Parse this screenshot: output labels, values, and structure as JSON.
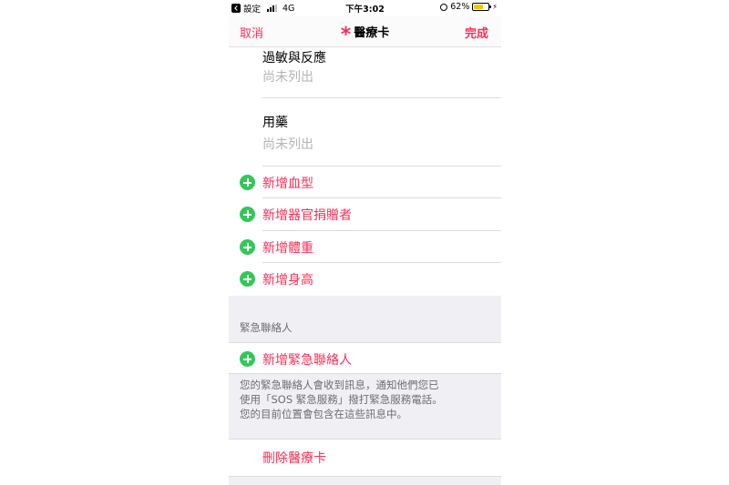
{
  "status_bar": {
    "back_app": "設定",
    "network": "4G",
    "time": "下午3:02",
    "battery": "62%"
  },
  "nav": {
    "cancel_label": "取消",
    "title": "醫療卡",
    "done_label": "完成"
  },
  "medical": {
    "allergies_label": "過敏與反應",
    "allergies_value": "尚未列出",
    "medications_label": "用藥",
    "medications_value": "尚未列出"
  },
  "add_items": [
    "新增血型",
    "新增器官捐贈者",
    "新增體重",
    "新增身高"
  ],
  "emergency": {
    "header": "緊急聯絡人",
    "add_label": "新增緊急聯絡人",
    "footer_lines": [
      "您的緊急聯絡人會收到訊息，通知他們您已",
      "使用「SOS 緊急服務」撥打緊急服務電話。",
      "您的目前位置會包含在這些訊息中。"
    ]
  },
  "delete_label": "刪除醫療卡",
  "colors": {
    "accent": "#ff2d55",
    "add_green": "#34c759",
    "muted_text": "#b4b4b8",
    "group_background": "#efeff4"
  }
}
